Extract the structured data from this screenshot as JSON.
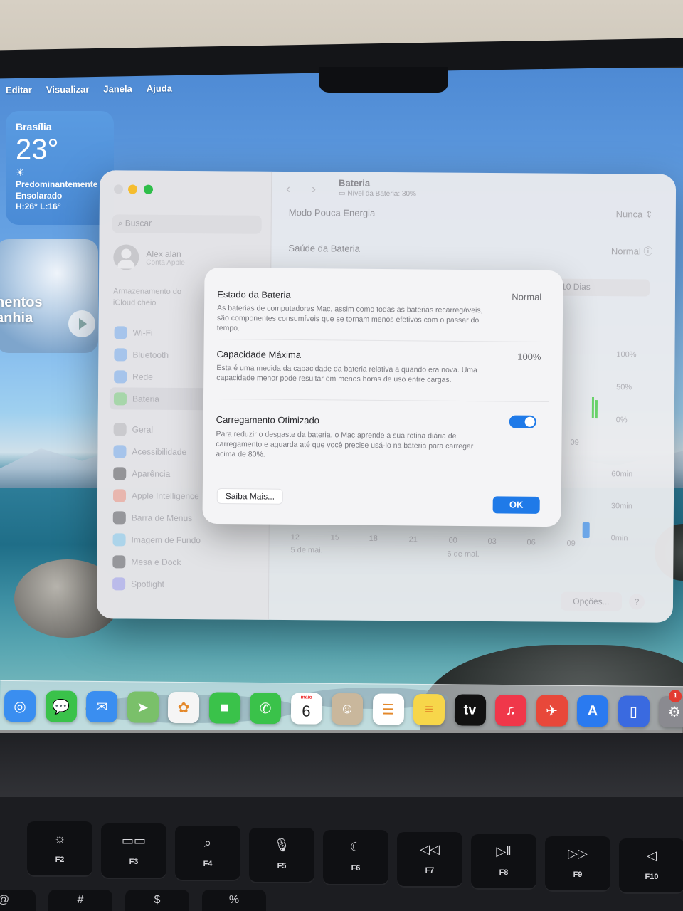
{
  "menu_bar": {
    "items": [
      "Editar",
      "Visualizar",
      "Janela",
      "Ajuda"
    ]
  },
  "weather_widget": {
    "city": "Brasília",
    "temperature": "23°",
    "condition_line1": "Predominantemente",
    "condition_line2": "Ensolarado",
    "high_low": "H:26° L:16°"
  },
  "memories_widget": {
    "line1": "nentos",
    "line2": "anhia"
  },
  "settings_window": {
    "sidebar": {
      "search_placeholder": "Buscar",
      "account_name": "Alex alan",
      "account_sub": "Conta Apple",
      "storage_note": "Armazenamento do iCloud cheio",
      "items": [
        "Wi-Fi",
        "Bluetooth",
        "Rede",
        "Bateria",
        "Geral",
        "Acessibilidade",
        "Aparência",
        "Apple Intelligence",
        "Barra de Menus",
        "Imagem de Fundo",
        "Mesa e Dock",
        "Spotlight"
      ],
      "selected": "Bateria",
      "icon_colors": [
        "#5a9ef0",
        "#5a9ef0",
        "#5a9ef0",
        "#6ad36a",
        "#aaaaaf",
        "#5a9ef0",
        "#333338",
        "#f07f6a",
        "#3a3a40",
        "#6ac0f0",
        "#3a3a40",
        "#8a8af0"
      ]
    },
    "header": {
      "title": "Bateria",
      "battery_level": "Nível da Bateria: 30%"
    },
    "rows": {
      "low_power_label": "Modo Pouca Energia",
      "low_power_value": "Nunca",
      "health_label": "Saúde da Bateria",
      "health_value": "Normal"
    },
    "segment_label": "10 Dias",
    "chart_y_labels": [
      "100%",
      "50%",
      "0%",
      "60min",
      "30min",
      "0min"
    ],
    "chart_x_labels": [
      "12",
      "15",
      "18",
      "21",
      "00",
      "03",
      "06",
      "09"
    ],
    "chart_x_top_label": "09",
    "chart_dates": [
      "5 de mai.",
      "6 de mai."
    ],
    "options_button": "Opções...",
    "help_button": "?"
  },
  "dialog": {
    "state_title": "Estado da Bateria",
    "state_value": "Normal",
    "state_desc": "As baterias de computadores Mac, assim como todas as baterias recarregáveis, são componentes consumíveis que se tornam menos efetivos com o passar do tempo.",
    "capacity_title": "Capacidade Máxima",
    "capacity_value": "100%",
    "capacity_desc": "Esta é uma medida da capacidade da bateria relativa a quando era nova. Uma capacidade menor pode resultar em menos horas de uso entre cargas.",
    "optimized_title": "Carregamento Otimizado",
    "optimized_enabled": true,
    "optimized_desc": "Para reduzir o desgaste da bateria, o Mac aprende a sua rotina diária de carregamento e aguarda até que você precise usá-lo na bateria para carregar acima de 80%.",
    "learn_more_button": "Saiba Mais...",
    "ok_button": "OK",
    "accent_color": "#1f7ae8"
  },
  "dock": {
    "apps": [
      {
        "name": "safari-icon",
        "color": "#3a8ef0",
        "glyph": "◎"
      },
      {
        "name": "messages-icon",
        "color": "#3ac24a",
        "glyph": "💬"
      },
      {
        "name": "mail-icon",
        "color": "#3a8ef0",
        "glyph": "✉"
      },
      {
        "name": "maps-icon",
        "color": "#7ac06a",
        "glyph": "➤"
      },
      {
        "name": "photos-icon",
        "color": "#f5f5f5",
        "glyph": "✿"
      },
      {
        "name": "facetime-icon",
        "color": "#3ac24a",
        "glyph": "■"
      },
      {
        "name": "phone-icon",
        "color": "#3ac24a",
        "glyph": "✆"
      },
      {
        "name": "calendar-icon",
        "color": "#ffffff",
        "glyph": ""
      },
      {
        "name": "contacts-icon",
        "color": "#c9b79c",
        "glyph": "☺"
      },
      {
        "name": "reminders-icon",
        "color": "#ffffff",
        "glyph": "☰"
      },
      {
        "name": "notes-icon",
        "color": "#f7d64a",
        "glyph": "≡"
      },
      {
        "name": "appletv-icon",
        "color": "#111111",
        "glyph": "tv"
      },
      {
        "name": "music-icon",
        "color": "#f0374a",
        "glyph": "♫"
      },
      {
        "name": "keynote-icon",
        "color": "#e8483a",
        "glyph": "✈"
      },
      {
        "name": "appstore-icon",
        "color": "#2a7af0",
        "glyph": "A"
      },
      {
        "name": "iphone-mirroring-icon",
        "color": "#3a6ae0",
        "glyph": "▯"
      },
      {
        "name": "system-settings-icon",
        "color": "#8a8a90",
        "glyph": "⚙"
      }
    ],
    "calendar_month": "maio",
    "calendar_day": "6",
    "settings_badge": "1"
  },
  "keyboard": {
    "keys": [
      {
        "icon": "☼",
        "label": "F2"
      },
      {
        "icon": "▭▭",
        "label": "F3"
      },
      {
        "icon": "⌕",
        "label": "F4"
      },
      {
        "icon": "🎙",
        "label": "F5"
      },
      {
        "icon": "☾",
        "label": "F6"
      },
      {
        "icon": "◁◁",
        "label": "F7"
      },
      {
        "icon": "▷‖",
        "label": "F8"
      },
      {
        "icon": "▷▷",
        "label": "F9"
      },
      {
        "icon": "◁",
        "label": "F10"
      }
    ],
    "lower_keys": [
      "@",
      "#",
      "$",
      "%"
    ]
  }
}
